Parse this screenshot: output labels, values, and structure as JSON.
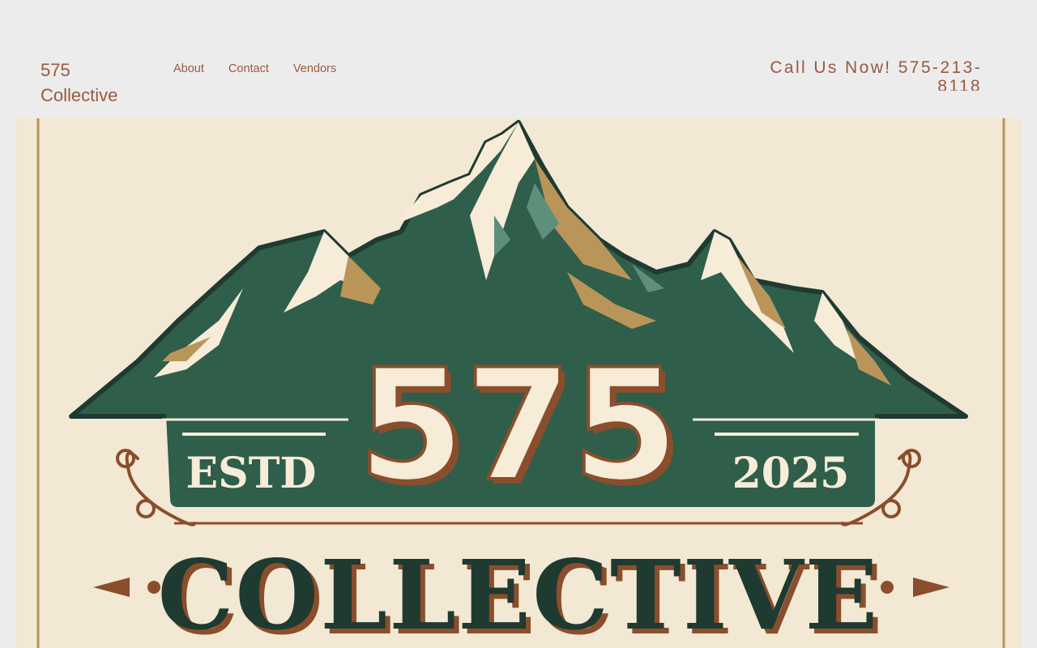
{
  "header": {
    "brand": "575 Collective",
    "nav": [
      {
        "label": "About"
      },
      {
        "label": "Contact"
      },
      {
        "label": "Vendors"
      }
    ],
    "call_us": "Call Us Now! 575-213-8118"
  },
  "hero": {
    "logo": {
      "number": "575",
      "name": "COLLECTIVE",
      "estd_label": "ESTD",
      "year": "2025"
    },
    "colors": {
      "background": "#f2e8d3",
      "green": "#2f5e4b",
      "dark_green": "#1f3a30",
      "brown": "#8a4e2c",
      "tan": "#b9955a",
      "cream": "#f6ecd8"
    }
  }
}
